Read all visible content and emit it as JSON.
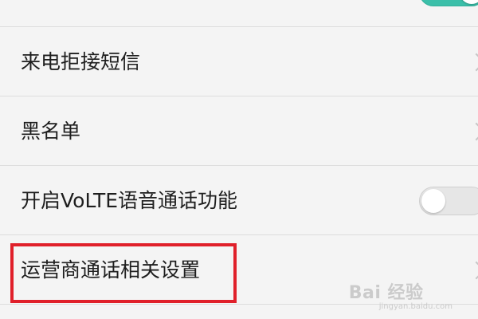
{
  "settings": {
    "items": [
      {
        "label": "",
        "control": "toggle-on"
      },
      {
        "label": "来电拒接短信",
        "control": "chevron"
      },
      {
        "label": "黑名单",
        "control": "chevron"
      },
      {
        "label": "开启VoLTE语音通话功能",
        "control": "toggle-off"
      },
      {
        "label": "运营商通话相关设置",
        "control": "chevron"
      }
    ]
  },
  "watermark": {
    "brand": "Bai  经验",
    "sub": "jingyan.baidu.com"
  },
  "colors": {
    "accent": "#3bbfa9",
    "highlight": "#e0202a"
  }
}
